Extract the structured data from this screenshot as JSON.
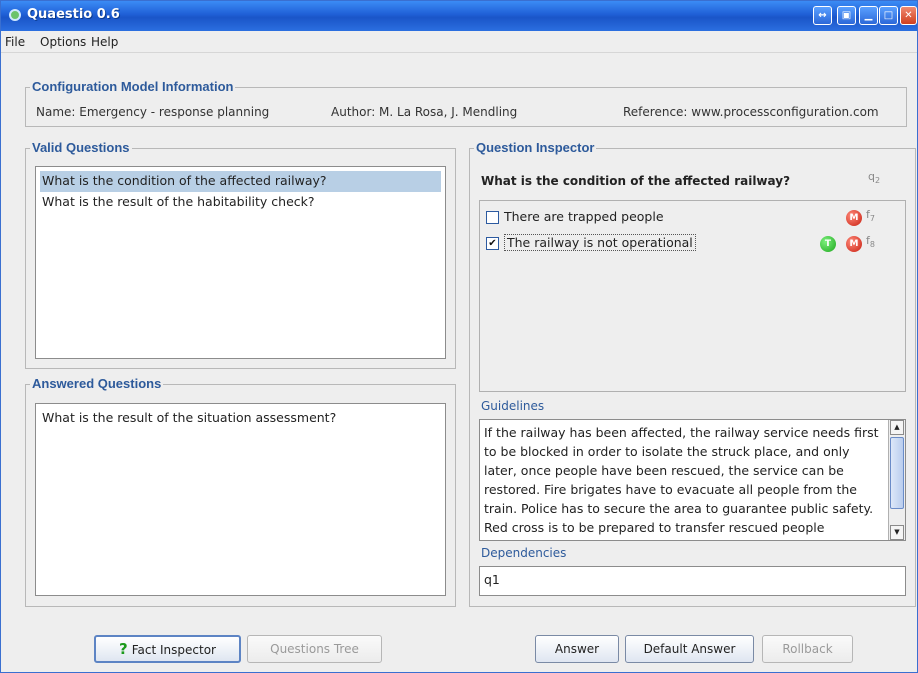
{
  "window": {
    "title": "Quaestio 0.6",
    "controls": [
      "swap-icon",
      "restore-icon",
      "minimize-icon",
      "maximize-icon",
      "close-icon"
    ]
  },
  "menu": [
    "File",
    "Options",
    "Help"
  ],
  "config": {
    "title": "Configuration Model Information",
    "name": "Name: Emergency - response planning",
    "author": "Author: M. La Rosa, J. Mendling",
    "reference": "Reference: www.processconfiguration.com"
  },
  "valid_questions": {
    "title": "Valid Questions",
    "items": [
      "What is the condition of the affected railway?",
      "What is the result of the habitability check?"
    ]
  },
  "answered_questions": {
    "title": "Answered Questions",
    "items": [
      "What is the result of the situation assessment?"
    ]
  },
  "inspector": {
    "title": "Question Inspector",
    "question": "What is the condition of the affected railway?",
    "question_id": "q",
    "question_id_sub": "2",
    "facts": [
      {
        "label": "There are trapped people",
        "checked": false,
        "badges": [
          "M"
        ],
        "id": "f",
        "id_sub": "7"
      },
      {
        "label": "The railway is not operational",
        "checked": true,
        "badges": [
          "T",
          "M"
        ],
        "id": "f",
        "id_sub": "8"
      }
    ],
    "guidelines_label": "Guidelines",
    "guidelines": "If the railway has been affected, the railway service needs first to be blocked in order to isolate the struck place, and only later, once people have been rescued, the service can be restored. Fire brigates have to evacuate all people from the train. Police has to secure the area to guarantee public safety. Red cross is to be prepared to transfer rescued people",
    "dependencies_label": "Dependencies",
    "dependencies": "q1"
  },
  "buttons": {
    "fact_inspector": "Fact Inspector",
    "questions_tree": "Questions Tree",
    "answer": "Answer",
    "default_answer": "Default Answer",
    "rollback": "Rollback"
  },
  "colors": {
    "title_bar": "#1f5fd6",
    "group_title": "#2d5a9b",
    "selection": "#b8cfe5",
    "badge_m": "#c81e10",
    "badge_t": "#1ea61e"
  }
}
